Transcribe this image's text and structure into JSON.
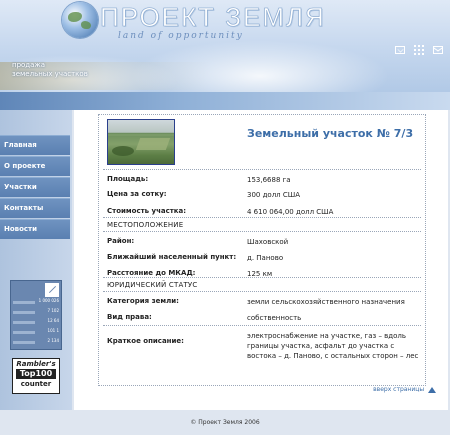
{
  "header": {
    "logo_title": "ПРОЕКТ ЗЕМЛЯ",
    "logo_tagline": "land of opportunity",
    "caption_line1": "продажа",
    "caption_line2": "земельных участков",
    "icons": [
      "mail-icon",
      "sitemap-grid-icon",
      "contact-mail-icon"
    ]
  },
  "nav": {
    "items": [
      "Главная",
      "О проекте",
      "Участки",
      "Контакты",
      "Новости"
    ]
  },
  "counter": {
    "stats": [
      "1 000 026",
      "7 102",
      "12 64",
      "101 1",
      "2 134"
    ],
    "rambler_line1": "Rambler's",
    "rambler_line2": "Top100",
    "rambler_line3": "counter"
  },
  "listing": {
    "title": "Земельный участок № 7/3",
    "area_label": "Площадь:",
    "area_value": "153,6688 га",
    "price_per_sotka_label": "Цена за сотку:",
    "price_per_sotka_value": "300 долл США",
    "total_price_label": "Стоимость участка:",
    "total_price_value": "4 610 064,00 долл США",
    "location_heading": "МЕСТОПОЛОЖЕНИЕ",
    "district_label": "Район:",
    "district_value": "Шаховской",
    "nearest_label": "Ближайший населенный пункт:",
    "nearest_value": "д. Паново",
    "distance_label": "Расстояние до МКАД:",
    "distance_value": "125 км",
    "legal_heading": "ЮРИДИЧЕСКИЙ СТАТУС",
    "category_label": "Категория земли:",
    "category_value": "земли сельскохозяйственного назначения",
    "right_label": "Вид права:",
    "right_value": "собственность",
    "description_label": "Краткое описание:",
    "description_value": "электроснабжение на участке, газ – вдоль границы участка, асфальт до участка с востока – д. Паново, с остальных сторон – лес"
  },
  "to_top_label": "вверх страницы",
  "footer": {
    "copyright": "© Проект Земля 2006"
  }
}
